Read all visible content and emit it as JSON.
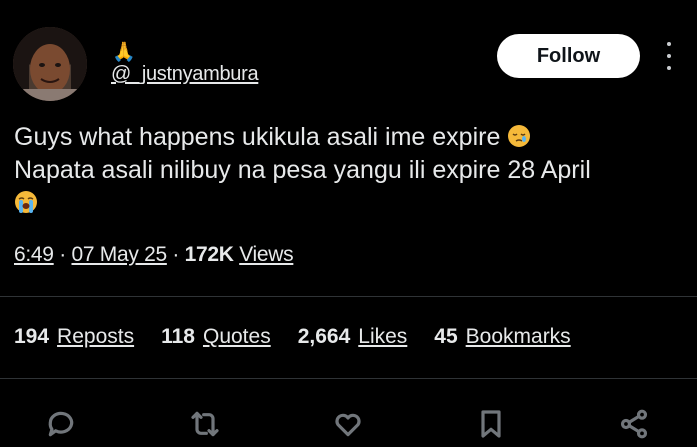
{
  "author": {
    "display_name": "🙏",
    "handle": "@_justnyambura",
    "follow_label": "Follow"
  },
  "tweet": {
    "line1": "Guys what happens ukikula asali ime expire",
    "line2": "Napata asali nilibuy na pesa yangu ili expire 28 April",
    "emoji1": "sleepy-face-emoji",
    "emoji2": "loudly-crying-face-emoji"
  },
  "meta": {
    "time": "6:49",
    "separator": "·",
    "date": "07 May 25",
    "views_count": "172K",
    "views_label": "Views"
  },
  "stats": {
    "reposts_count": "194",
    "reposts_label": "Reposts",
    "quotes_count": "118",
    "quotes_label": "Quotes",
    "likes_count": "2,664",
    "likes_label": "Likes",
    "bookmarks_count": "45",
    "bookmarks_label": "Bookmarks"
  },
  "actions": [
    "reply-icon",
    "repost-icon",
    "like-icon",
    "bookmark-icon",
    "share-icon"
  ],
  "colors": {
    "background": "#000000",
    "text": "#e7e9ea",
    "icon": "#71767b",
    "divider": "#2f3336",
    "follow_bg": "#ffffff"
  }
}
